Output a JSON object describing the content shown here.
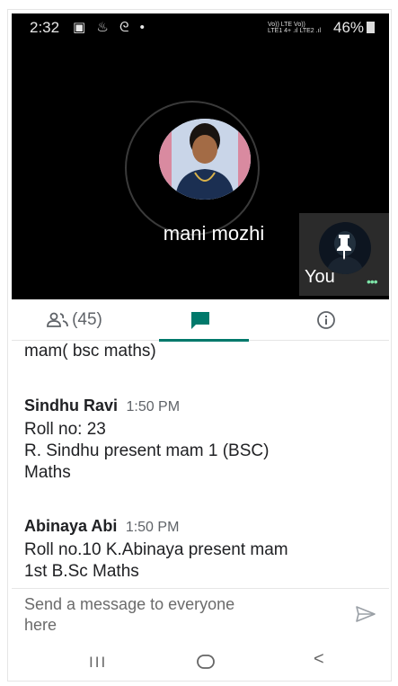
{
  "status_bar": {
    "time": "2:32",
    "left_icons": "▣ ♨ ᘓ •",
    "signal_line1": "Vo)) LTE  Vo))",
    "signal_line2": "LTE1 4+ .ıl LTE2 .ıl",
    "battery": "46%"
  },
  "call": {
    "speaker_name": "mani mozhi",
    "self_label": "You",
    "more_dots": "•••",
    "colors": {
      "background": "#000000",
      "tile": "#2b2b2b",
      "dots": "#7de3a7"
    }
  },
  "tabs": {
    "people_count": "(45)",
    "people_icon": "people-icon",
    "chat_icon": "chat-icon",
    "info_icon": "info-icon",
    "accent": "#00796b"
  },
  "chat": {
    "continued_text": "mam( bsc maths)",
    "messages": [
      {
        "sender": "Sindhu Ravi",
        "time": "1:50 PM",
        "lines": [
          "Roll no: 23",
          "R. Sindhu present mam 1  (BSC)",
          "Maths"
        ]
      },
      {
        "sender": "Abinaya Abi",
        "time": "1:50 PM",
        "lines": [
          "Roll no.10 K.Abinaya present mam",
          "1st B.Sc Maths"
        ]
      }
    ]
  },
  "compose": {
    "placeholder_line1": "Send a message to everyone",
    "placeholder_line2": "here",
    "send_icon": "send-icon"
  },
  "navbar": {
    "recents": "III",
    "home_icon": "home-icon",
    "back": "<"
  }
}
